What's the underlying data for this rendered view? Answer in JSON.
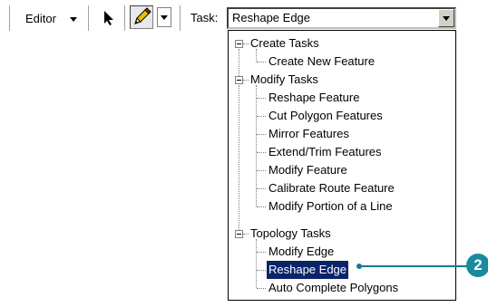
{
  "toolbar": {
    "editor_label": "Editor",
    "task_label": "Task:",
    "task_value": "Reshape Edge"
  },
  "tree": {
    "groups": [
      {
        "label": "Create Tasks",
        "items": [
          "Create New Feature"
        ]
      },
      {
        "label": "Modify Tasks",
        "items": [
          "Reshape Feature",
          "Cut Polygon Features",
          "Mirror Features",
          "Extend/Trim Features",
          "Modify Feature",
          "Calibrate Route Feature",
          "Modify Portion of a Line"
        ]
      },
      {
        "label": "Topology Tasks",
        "items": [
          "Modify Edge",
          "Reshape Edge",
          "Auto Complete Polygons"
        ]
      }
    ],
    "selected": "Reshape Edge"
  },
  "callout": {
    "number": "2",
    "color": "#1a8a9e"
  },
  "colors": {
    "selection": "#0a246a"
  },
  "icons": [
    "pointer-arrow-icon",
    "pencil-icon",
    "chevron-down-icon"
  ]
}
